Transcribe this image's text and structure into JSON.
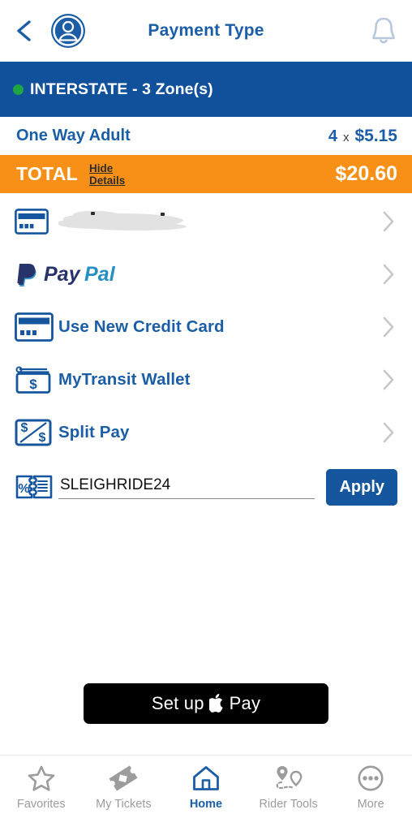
{
  "header": {
    "title": "Payment Type",
    "back_icon": "chevron-left-icon",
    "avatar_icon": "user-avatar-icon",
    "bell_icon": "notification-bell-icon"
  },
  "zone_banner": {
    "text": "INTERSTATE - 3 Zone(s)",
    "status_color": "#1FA544",
    "background": "#11519C"
  },
  "fare": {
    "name": "One Way Adult",
    "quantity": "4",
    "multiplier": "x",
    "unit_price": "$5.15"
  },
  "total": {
    "label": "TOTAL",
    "details_link": "Hide Details",
    "amount": "$20.60",
    "background": "#F89018"
  },
  "payment_methods": [
    {
      "label": "",
      "icon": "credit-card-icon",
      "redacted": true,
      "name": "saved-card"
    },
    {
      "label": "PayPal",
      "icon": "paypal-logo-icon",
      "redacted": false,
      "name": "paypal"
    },
    {
      "label": "Use New Credit Card",
      "icon": "credit-card-icon",
      "redacted": false,
      "name": "new-credit-card"
    },
    {
      "label": "MyTransit Wallet",
      "icon": "wallet-icon",
      "redacted": false,
      "name": "mytransit-wallet"
    },
    {
      "label": "Split Pay",
      "icon": "split-pay-icon",
      "redacted": false,
      "name": "split-pay"
    }
  ],
  "promo": {
    "icon": "coupon-percent-icon",
    "value": "SLEIGHRIDE24",
    "placeholder": "Promo Code",
    "apply_label": "Apply",
    "apply_color": "#15569E"
  },
  "apple_pay": {
    "label_before": "Set up",
    "label_after": "Pay",
    "icon": "apple-logo-icon"
  },
  "bottom_nav": [
    {
      "label": "Favorites",
      "icon": "star-icon",
      "active": false
    },
    {
      "label": "My Tickets",
      "icon": "ticket-icon",
      "active": false
    },
    {
      "label": "Home",
      "icon": "home-icon",
      "active": true
    },
    {
      "label": "Rider Tools",
      "icon": "map-pins-icon",
      "active": false
    },
    {
      "label": "More",
      "icon": "more-dots-icon",
      "active": false
    }
  ],
  "colors": {
    "brand_blue": "#1B5EA6",
    "banner_blue": "#11519C",
    "orange": "#F89018",
    "green": "#1FA544",
    "chevron_gray": "#C8C8C8",
    "nav_gray": "#9C9C9C"
  }
}
